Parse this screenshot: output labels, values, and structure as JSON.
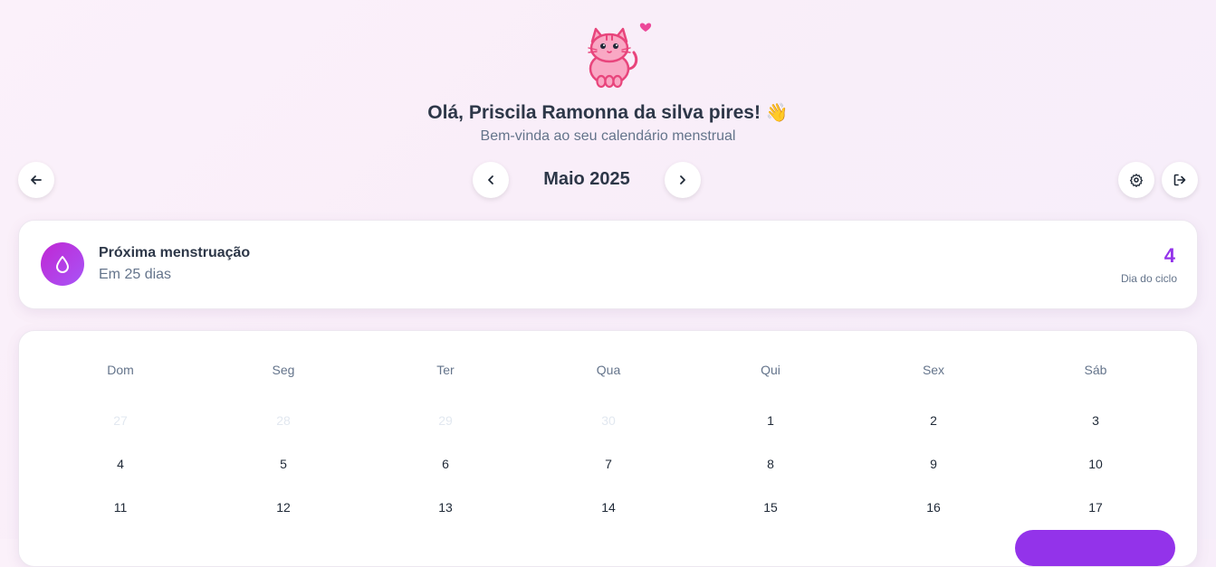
{
  "header": {
    "greeting": "Olá, Priscila Ramonna da silva pires!",
    "greeting_emoji": "👋",
    "subtitle": "Bem-vinda ao seu calendário menstrual"
  },
  "nav": {
    "month_title": "Maio 2025",
    "icons": {
      "back": "arrow-left-icon",
      "prev": "chevron-left-icon",
      "next": "chevron-right-icon",
      "settings": "gear-icon",
      "logout": "logout-icon"
    }
  },
  "next_period": {
    "title": "Próxima menstruação",
    "subtitle": "Em 25 dias",
    "cycle_day": "4",
    "cycle_label": "Dia do ciclo",
    "icon": "drop-icon"
  },
  "calendar": {
    "weekdays": [
      "Dom",
      "Seg",
      "Ter",
      "Qua",
      "Qui",
      "Sex",
      "Sáb"
    ],
    "weeks": [
      [
        {
          "d": "27",
          "muted": true
        },
        {
          "d": "28",
          "muted": true
        },
        {
          "d": "29",
          "muted": true
        },
        {
          "d": "30",
          "muted": true
        },
        {
          "d": "1",
          "muted": false
        },
        {
          "d": "2",
          "muted": false
        },
        {
          "d": "3",
          "muted": false
        }
      ],
      [
        {
          "d": "4",
          "muted": false
        },
        {
          "d": "5",
          "muted": false
        },
        {
          "d": "6",
          "muted": false
        },
        {
          "d": "7",
          "muted": false
        },
        {
          "d": "8",
          "muted": false
        },
        {
          "d": "9",
          "muted": false
        },
        {
          "d": "10",
          "muted": false
        }
      ],
      [
        {
          "d": "11",
          "muted": false
        },
        {
          "d": "12",
          "muted": false
        },
        {
          "d": "13",
          "muted": false
        },
        {
          "d": "14",
          "muted": false
        },
        {
          "d": "15",
          "muted": false
        },
        {
          "d": "16",
          "muted": false
        },
        {
          "d": "17",
          "muted": false
        }
      ]
    ]
  },
  "colors": {
    "accent": "#9333ea",
    "badge_gradient_start": "#c026d3",
    "badge_gradient_end": "#a855f7",
    "mascot_pink": "#e8457c"
  }
}
